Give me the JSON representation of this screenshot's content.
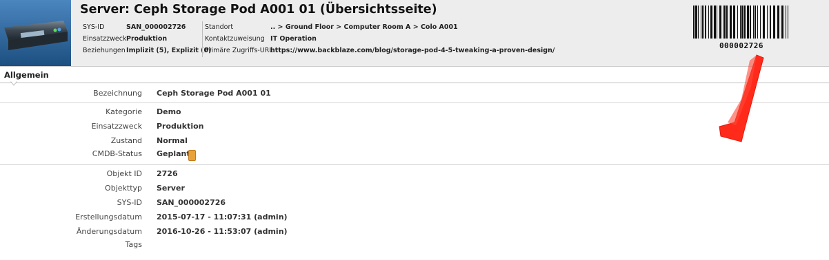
{
  "header": {
    "title": "Server: Ceph Storage Pod A001 01 (Übersichtsseite)",
    "col1": [
      {
        "label": "SYS-ID",
        "value": "SAN_000002726"
      },
      {
        "label": "Einsatzzweck",
        "value": "Produktion"
      },
      {
        "label": "Beziehungen",
        "value": "Implizit (5), Explizit (0)"
      }
    ],
    "col2": [
      {
        "label": "Standort",
        "value": ".. > Ground Floor > Computer Room A > Colo A001"
      },
      {
        "label": "Kontaktzuweisung",
        "value": "IT Operation"
      },
      {
        "label": "Primäre Zugriffs-URL",
        "value": "https://www.backblaze.com/blog/storage-pod-4-5-tweaking-a-proven-design/"
      }
    ],
    "barcode_text": "000002726",
    "thumbnail_icon": "server-image-icon"
  },
  "section": {
    "title": "Allgemein"
  },
  "fields": {
    "bezeichnung": {
      "label": "Bezeichnung",
      "value": "Ceph Storage Pod A001 01"
    },
    "kategorie": {
      "label": "Kategorie",
      "value": "Demo"
    },
    "einsatzzweck": {
      "label": "Einsatzzweck",
      "value": "Produktion"
    },
    "zustand": {
      "label": "Zustand",
      "value": "Normal"
    },
    "cmdb_status": {
      "label": "CMDB-Status",
      "value": "Geplant"
    },
    "objekt_id": {
      "label": "Objekt ID",
      "value": "2726"
    },
    "objekttyp": {
      "label": "Objekttyp",
      "value": "Server"
    },
    "sys_id": {
      "label": "SYS-ID",
      "value": "SAN_000002726"
    },
    "erstellungsdatum": {
      "label": "Erstellungsdatum",
      "value": "2015-07-17 - 11:07:31 (admin)"
    },
    "aenderungsdatum": {
      "label": "Änderungsdatum",
      "value": "2016-10-26 - 11:53:07 (admin)"
    },
    "tags": {
      "label": "Tags",
      "value": ""
    }
  },
  "colors": {
    "status_geplant": "#e9a23b",
    "annotation_arrow": "#ff2a1a",
    "header_bg": "#ededed"
  }
}
